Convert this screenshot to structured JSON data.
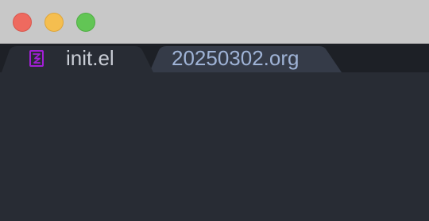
{
  "window": {
    "controls": [
      "close",
      "minimize",
      "zoom"
    ]
  },
  "tabs": [
    {
      "label": "init.el",
      "icon": "emacs-lisp-icon",
      "active": true
    },
    {
      "label": "20250302.org",
      "active": false
    }
  ],
  "colors": {
    "titlebar": "#c8c8c8",
    "tabbar": "#1d2026",
    "active_tab": "#282c34",
    "inactive_tab": "#353b48",
    "editor_bg": "#282c34",
    "icon_purple": "#a21fd6",
    "close": "#ee6a5f",
    "minimize": "#f5be4f",
    "zoom": "#62c555"
  }
}
